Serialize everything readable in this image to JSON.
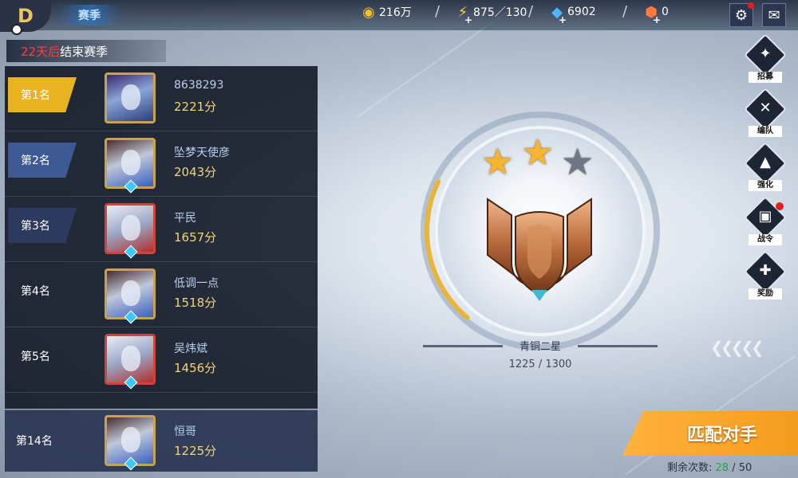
{
  "header": {
    "back_icon": "D",
    "page_title": "赛季",
    "resources": [
      {
        "name": "gold",
        "icon": "gold-coin-icon",
        "glyph": "◉",
        "color": "#f2c12e",
        "value": "216万"
      },
      {
        "name": "energy",
        "icon": "lightning-icon",
        "glyph": "⚡",
        "color": "#f7d23a",
        "value": "875／130"
      },
      {
        "name": "diamond",
        "icon": "diamond-icon",
        "glyph": "◆",
        "color": "#4fb6ff",
        "value": "6902"
      },
      {
        "name": "gem",
        "icon": "gem-icon",
        "glyph": "⬢",
        "color": "#ff7a3c",
        "value": "0"
      }
    ],
    "separator": "/",
    "plus": "+",
    "settings_icon": "⚙",
    "mail_icon": "✉"
  },
  "season": {
    "days_left": "22天后",
    "suffix": "结束赛季"
  },
  "leaderboard": [
    {
      "rank": "第1名",
      "name": "8638293",
      "score": "2221分"
    },
    {
      "rank": "第2名",
      "name": "坠梦天使彦",
      "score": "2043分"
    },
    {
      "rank": "第3名",
      "name": "平民",
      "score": "1657分"
    },
    {
      "rank": "第4名",
      "name": "低调一点",
      "score": "1518分"
    },
    {
      "rank": "第5名",
      "name": "吴炜斌",
      "score": "1456分"
    }
  ],
  "self": {
    "rank": "第14名",
    "name": "恒哥",
    "score": "1225分"
  },
  "rank_info": {
    "tier": "青铜二星",
    "stars_total": 3,
    "stars_earned": 2,
    "progress": "1225 / 1300",
    "progress_fraction": 0.94,
    "star_glyph": "★"
  },
  "side_menu": [
    {
      "label": "招募",
      "icon": "recruit-icon",
      "glyph": "✦",
      "dot": false
    },
    {
      "label": "编队",
      "icon": "crossed-swords-icon",
      "glyph": "✕",
      "dot": false
    },
    {
      "label": "强化",
      "icon": "anvil-icon",
      "glyph": "▲",
      "dot": false
    },
    {
      "label": "战令",
      "icon": "scroll-icon",
      "glyph": "▣",
      "dot": true
    },
    {
      "label": "奖励",
      "icon": "gift-icon",
      "glyph": "✚",
      "dot": false
    }
  ],
  "match": {
    "button": "匹配对手",
    "remain_label": "剩余次数:",
    "remain_current": "28",
    "remain_sep": " / ",
    "remain_total": "50"
  },
  "colors": {
    "rank1": "#e7b321",
    "rank2": "#3d5a94",
    "rank3": "#2c3a5e",
    "accent_orange": "#f7a32b"
  }
}
